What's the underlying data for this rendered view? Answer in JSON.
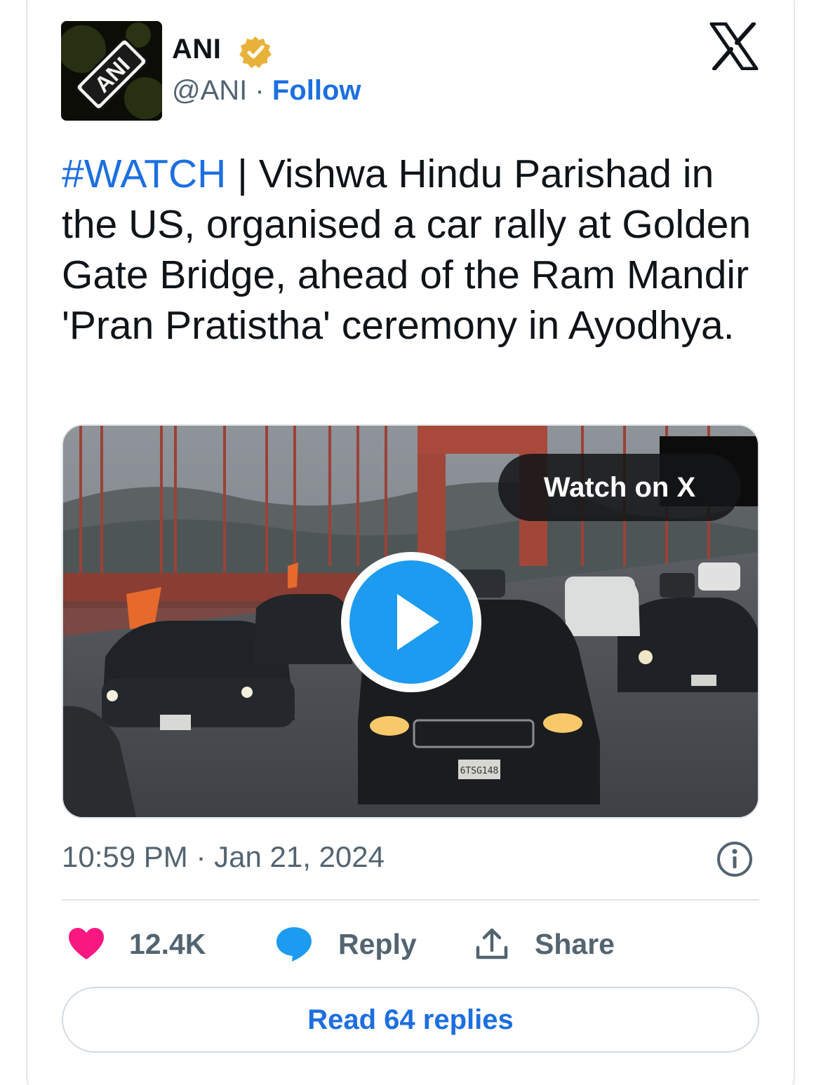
{
  "author": {
    "name": "ANI",
    "handle": "@ANI",
    "separator": " · ",
    "follow_label": "Follow",
    "avatar_text": "ANI",
    "verified_icon": "verified-badge-gold"
  },
  "platform_icon": "x-logo-icon",
  "tweet": {
    "hashtag": "#WATCH",
    "body": " | Vishwa Hindu Parishad in the US, organised a car rally at Golden Gate Bridge, ahead of the Ram Mandir 'Pran Pratistha' ceremony in Ayodhya."
  },
  "media": {
    "watch_label": "Watch on X",
    "play_icon": "play-icon",
    "license_plate_center": "6TSG148"
  },
  "timestamp": "10:59 PM · Jan 21, 2024",
  "actions": {
    "likes_count": "12.4K",
    "reply_label": "Reply",
    "share_label": "Share"
  },
  "read_replies_label": "Read 64 replies",
  "colors": {
    "accent": "#1d6fe0",
    "heart": "#f91880",
    "play": "#1d9bf0",
    "muted": "#536471"
  }
}
